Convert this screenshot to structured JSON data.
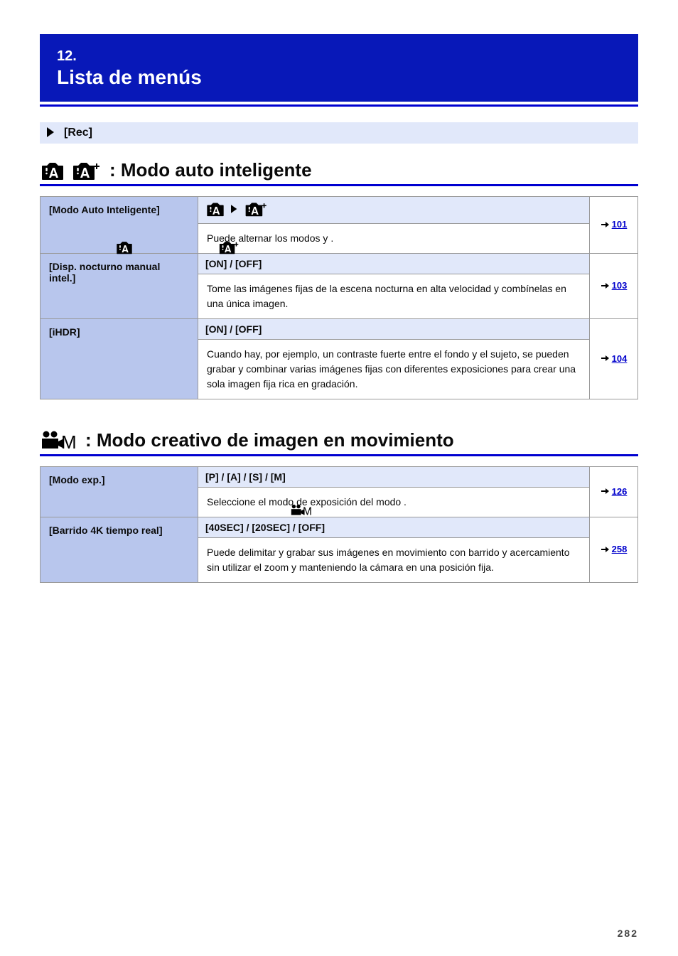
{
  "chapter": {
    "num": "12.",
    "title": "Lista de menús"
  },
  "subhead": "[Rec]",
  "iaSection": {
    "title": ": Modo auto inteligente",
    "rows": [
      {
        "setting": "[Modo Auto Inteligente]",
        "header_icons": [
          "iA",
          "iA+"
        ],
        "body": "Puede alternar los modos       y       .",
        "page": "101"
      },
      {
        "setting": "[Disp. nocturno manual intel.]",
        "header": "[ON] / [OFF]",
        "body": "Tome las imágenes fijas de la escena nocturna en alta velocidad y combínelas en una única imagen.",
        "page": "103"
      },
      {
        "setting": "[iHDR]",
        "header": "[ON] / [OFF]",
        "body": "Cuando hay, por ejemplo, un contraste fuerte entre el fondo y el sujeto, se pueden grabar y combinar varias imágenes fijas con diferentes exposiciones para crear una sola imagen fija rica en gradación.",
        "page": "104"
      }
    ]
  },
  "movieSection": {
    "title": ": Modo creativo de imagen en movimiento",
    "rows": [
      {
        "setting": "[Modo exp.]",
        "header": "[P] / [A] / [S] / [M]",
        "body": "Seleccione el modo de exposición del modo       .",
        "page": "126"
      },
      {
        "setting": "[Barrido 4K tiempo real]",
        "header": "[40SEC] / [20SEC] / [OFF]",
        "body": "Puede delimitar y grabar sus imágenes en movimiento con barrido y acercamiento sin utilizar el zoom y manteniendo la cámara en una posición fija.",
        "page": "258"
      }
    ]
  },
  "pageNumber": "282"
}
